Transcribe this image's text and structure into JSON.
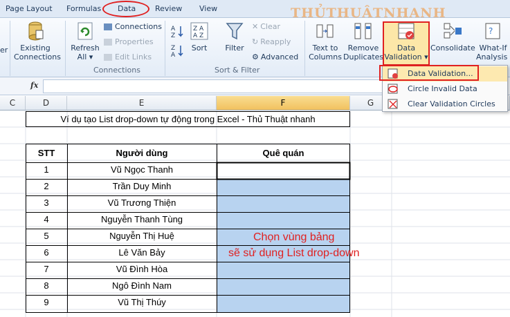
{
  "tabs": [
    "Page Layout",
    "Formulas",
    "Data",
    "Review",
    "View"
  ],
  "watermark": "THỦTHUẬTNHANH",
  "ribbon": {
    "partial_left": "er",
    "existing_connections": "Existing\nConnections",
    "refresh_all": "Refresh\nAll ▾",
    "connections": "Connections",
    "properties": "Properties",
    "edit_links": "Edit Links",
    "connections_group": "Connections",
    "sort": "Sort",
    "filter": "Filter",
    "clear": "Clear",
    "reapply": "Reapply",
    "advanced": "Advanced",
    "sort_filter_group": "Sort & Filter",
    "text_to_columns": "Text to\nColumns",
    "remove_duplicates": "Remove\nDuplicates",
    "data_validation": "Data\nValidation ▾",
    "consolidate": "Consolidate",
    "what_if": "What-If\nAnalysis ▾"
  },
  "formula_bar": {
    "fx": "fx",
    "value": ""
  },
  "columns": [
    "C",
    "D",
    "E",
    "F",
    "G"
  ],
  "menu": {
    "items": [
      "Data Validation...",
      "Circle Invalid Data",
      "Clear Validation Circles"
    ]
  },
  "sheet": {
    "title": "Ví dụ tạo List drop-down tự động trong Excel - Thủ Thuật nhanh",
    "headers": [
      "STT",
      "Người dùng",
      "Quê quán"
    ],
    "rows": [
      [
        "1",
        "Vũ Ngọc Thanh",
        ""
      ],
      [
        "2",
        "Trần Duy Minh",
        ""
      ],
      [
        "3",
        "Vũ Trương Thiện",
        ""
      ],
      [
        "4",
        "Nguyễn Thanh Tùng",
        ""
      ],
      [
        "5",
        "Nguyễn Thị Huệ",
        ""
      ],
      [
        "6",
        "Lê Văn Bảy",
        ""
      ],
      [
        "7",
        "Vũ Đình Hòa",
        ""
      ],
      [
        "8",
        "Ngô Đình Nam",
        ""
      ],
      [
        "9",
        "Vũ Thị Thúy",
        ""
      ]
    ]
  },
  "annotation": {
    "line1": "Chọn vùng bảng",
    "line2": "sẽ sử dụng List drop-down"
  },
  "colors": {
    "accent": "#e02020",
    "selection": "#b8d3f0",
    "highlight": "#fce7a8"
  }
}
